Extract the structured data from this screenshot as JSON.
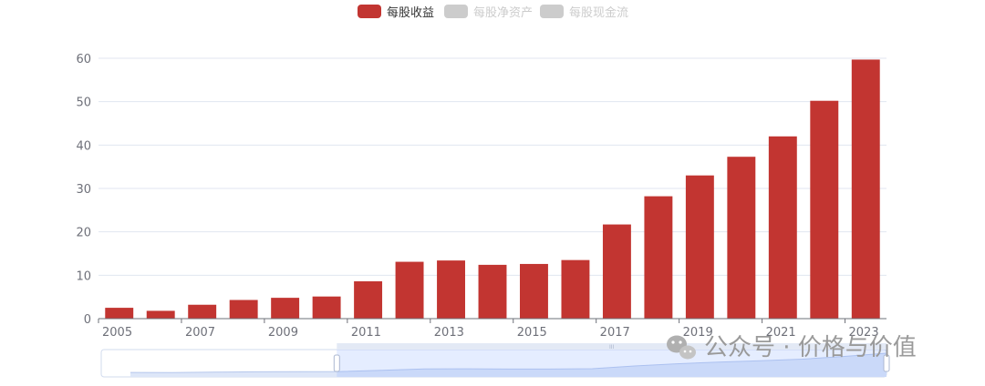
{
  "chart_data": {
    "type": "bar",
    "categories": [
      "2005",
      "2006",
      "2007",
      "2008",
      "2009",
      "2010",
      "2011",
      "2012",
      "2013",
      "2014",
      "2015",
      "2016",
      "2017",
      "2018",
      "2019",
      "2020",
      "2021",
      "2022",
      "2023"
    ],
    "x_tick_labels": [
      "2005",
      "2007",
      "2009",
      "2011",
      "2013",
      "2015",
      "2017",
      "2019",
      "2021",
      "2023"
    ],
    "series": [
      {
        "name": "每股收益",
        "color": "#c23531",
        "active": true,
        "values": [
          2.5,
          1.8,
          3.2,
          4.3,
          4.8,
          5.1,
          8.6,
          13.1,
          13.4,
          12.4,
          12.6,
          13.5,
          21.7,
          28.2,
          33.0,
          37.3,
          42.0,
          50.2,
          59.7
        ]
      },
      {
        "name": "每股净资产",
        "color": "#cccccc",
        "active": false,
        "values": []
      },
      {
        "name": "每股现金流",
        "color": "#cccccc",
        "active": false,
        "values": []
      }
    ],
    "ylim": [
      0,
      60
    ],
    "y_ticks": [
      0,
      10,
      20,
      30,
      40,
      50,
      60
    ],
    "grid": true,
    "legend": "top-center",
    "title": "",
    "xlabel": "",
    "ylabel": "",
    "data_zoom": {
      "start_fraction": 0.3,
      "end_fraction": 1.0,
      "handle_label": "III"
    }
  },
  "watermark": {
    "text": "公众号 · 价格与价值",
    "icon": "wechat-icon"
  }
}
